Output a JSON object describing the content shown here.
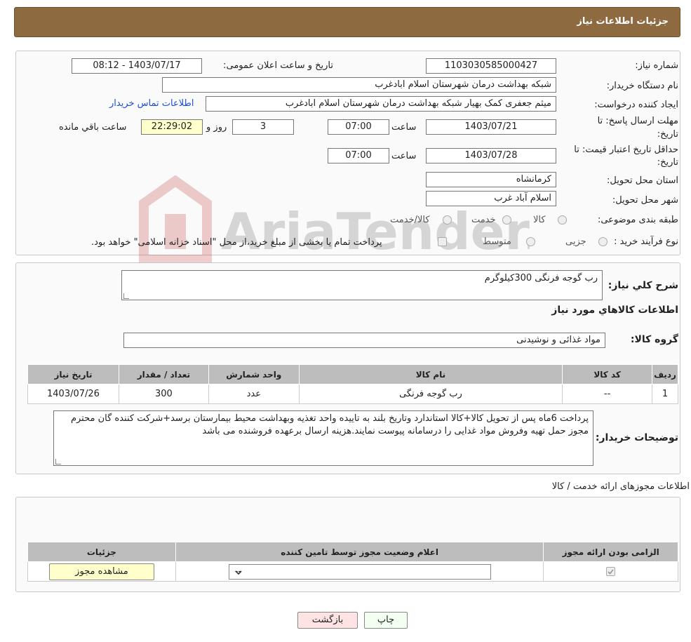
{
  "header": {
    "title": "جزئیات اطلاعات نیاز"
  },
  "form": {
    "need_number_label": "شماره نیاز:",
    "need_number": "1103030585000427",
    "announce_label": "تاریخ و ساعت اعلان عمومی:",
    "announce_value": "1403/07/17 - 08:12",
    "buyer_org_label": "نام دستگاه خریدار:",
    "buyer_org": "شبکه بهداشت درمان شهرستان اسلام ابادغرب",
    "requester_label": "ایجاد کننده درخواست:",
    "requester": "میثم جعفری کمک بهیار شبکه بهداشت درمان شهرستان اسلام ابادغرب",
    "contact_link": "اطلاعات تماس خریدار",
    "deadline_label_1": "مهلت ارسال پاسخ: تا",
    "deadline_label_2": "تاریخ:",
    "deadline_date": "1403/07/21",
    "time_label": "ساعت",
    "deadline_time": "07:00",
    "days_value": "3",
    "days_label": "روز و",
    "remaining_time": "22:29:02",
    "remaining_label": "ساعت باقي مانده",
    "validity_label_1": "حداقل تاریخ اعتبار قیمت: تا",
    "validity_label_2": "تاریخ:",
    "validity_date": "1403/07/28",
    "validity_time": "07:00",
    "province_label": "استان محل تحویل:",
    "province": "کرمانشاه",
    "city_label": "شهر محل تحویل:",
    "city": "اسلام آباد غرب",
    "category_label": "طبقه بندی موضوعی:",
    "category_options": [
      "کالا",
      "خدمت",
      "کالا/خدمت"
    ],
    "process_label": "نوع فرآیند خرید :",
    "process_options": [
      "جزیی",
      "متوسط"
    ],
    "payment_note": "پرداخت تمام یا بخشی از مبلغ خرید،از محل \"اسناد خزانه اسلامی\" خواهد بود."
  },
  "summary": {
    "desc_label": "شرح کلي نياز:",
    "desc_value": "رب گوجه فرنگی 300کیلوگرم",
    "goods_title": "اطلاعات کالاهاي مورد نياز",
    "group_label": "گروه کالا:",
    "group_value": "مواد غذائی و نوشیدنی",
    "table": {
      "headers": [
        "رديف",
        "کد کالا",
        "نام کالا",
        "واحد شمارش",
        "تعداد / مقدار",
        "تاریخ نیاز"
      ],
      "rows": [
        [
          "1",
          "--",
          "رب گوجه فرنگی",
          "عدد",
          "300",
          "1403/07/26"
        ]
      ]
    },
    "buyer_notes_label": "توضیحات خریدار:",
    "buyer_notes": "پرداخت 6ماه پس از تحویل کالا+کالا استاندارد وتاریخ بلند به تاییده واحد تغذیه وبهداشت محیط بیمارستان برسد+شرکت کننده گان محترم مجوز حمل تهیه وفروش مواد غدایی  را درسامانه پیوست نمایند.هزینه ارسال برعهده فروشنده می باشد"
  },
  "licenses": {
    "title": "اطلاعات مجوزهای ارائه خدمت / کالا",
    "headers": [
      "الزامی بودن ارائه مجوز",
      "اعلام وضعیت مجوز توسط تامین کننده",
      "جزئیات"
    ],
    "select_value": "--",
    "view_button": "مشاهده مجوز"
  },
  "footer": {
    "print_button": "چاپ",
    "back_button": "بازگشت"
  },
  "watermark": {
    "text": "AriaTender.neT"
  },
  "colors": {
    "header_bg": "#8d6a3f",
    "link": "#1a4fd6",
    "yellow_box": "#ffffcc",
    "back_btn": "#fde3e3",
    "print_btn": "#f3fff0"
  }
}
